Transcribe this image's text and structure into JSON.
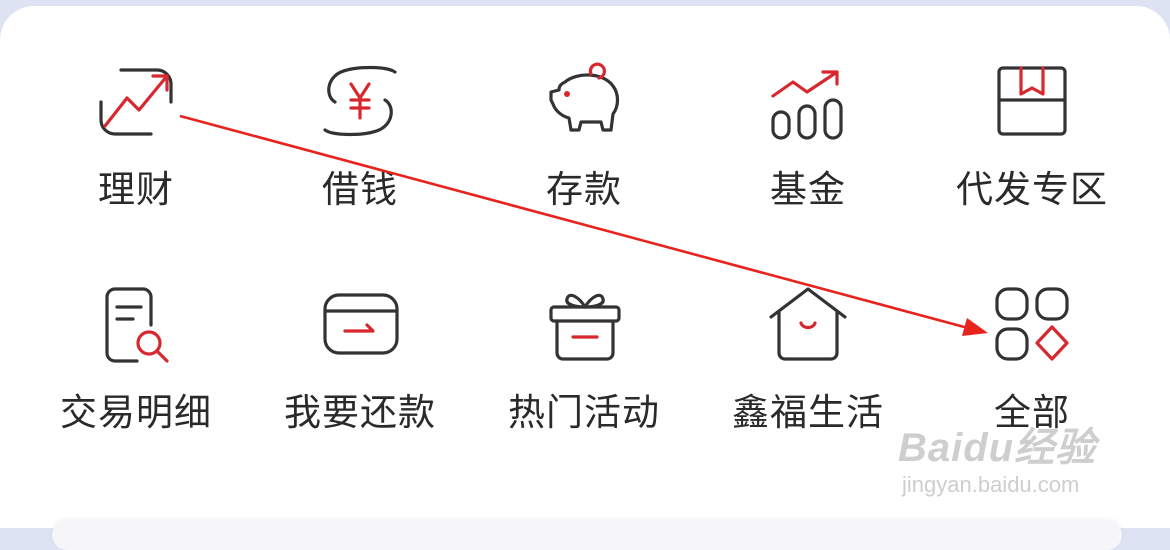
{
  "menu": {
    "items": [
      {
        "label": "理财",
        "icon": "chart-trend-icon"
      },
      {
        "label": "借钱",
        "icon": "yen-loan-icon"
      },
      {
        "label": "存款",
        "icon": "piggy-bank-icon"
      },
      {
        "label": "基金",
        "icon": "fund-growth-icon"
      },
      {
        "label": "代发专区",
        "icon": "package-box-icon"
      },
      {
        "label": "交易明细",
        "icon": "document-search-icon"
      },
      {
        "label": "我要还款",
        "icon": "card-repay-icon"
      },
      {
        "label": "热门活动",
        "icon": "gift-icon"
      },
      {
        "label": "鑫福生活",
        "icon": "house-smile-icon"
      },
      {
        "label": "全部",
        "icon": "all-apps-icon"
      }
    ]
  },
  "colors": {
    "accent": "#d7282f",
    "icon_stroke": "#333333",
    "text": "#2a2a2a",
    "annotation_arrow": "#e8231d"
  },
  "watermark": {
    "logo": "Baidu经验",
    "url": "jingyan.baidu.com"
  }
}
